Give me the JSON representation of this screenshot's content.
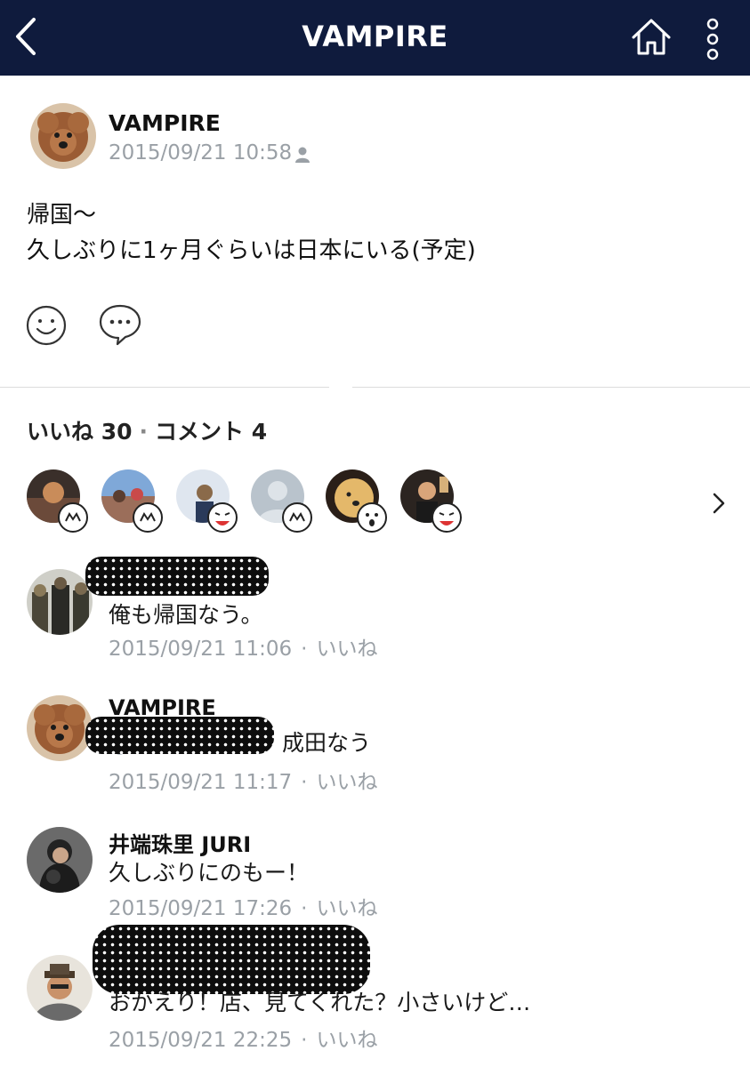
{
  "header": {
    "title": "VAMPIRE"
  },
  "post": {
    "author": "VAMPIRE",
    "timestamp": "2015/09/21 10:58",
    "body_line1": "帰国〜",
    "body_line2": "久しぶりに1ヶ月ぐらいは日本にいる(予定)"
  },
  "stats": {
    "likes_label": "いいね 30",
    "dot": "·",
    "comments_label": "コメント 4"
  },
  "comments": [
    {
      "name": "",
      "text": "俺も帰国なう。",
      "timestamp": "2015/09/21 11:06",
      "like_label": "いいね"
    },
    {
      "name": "VAMPIRE",
      "text": "@",
      "text_after": "成田なう",
      "timestamp": "2015/09/21 11:17",
      "like_label": "いいね"
    },
    {
      "name": "井端珠里 JURI",
      "text": "久しぶりにのもー！",
      "timestamp": "2015/09/21 17:26",
      "like_label": "いいね"
    },
    {
      "name": "",
      "text": "おかえり！店、見てくれた？小さいけど…",
      "timestamp": "2015/09/21 22:25",
      "like_label": "いいね"
    }
  ],
  "meta_separator": "·",
  "colors": {
    "header_bg": "#0f1b3d",
    "meta_gray": "#9aa0a6"
  }
}
